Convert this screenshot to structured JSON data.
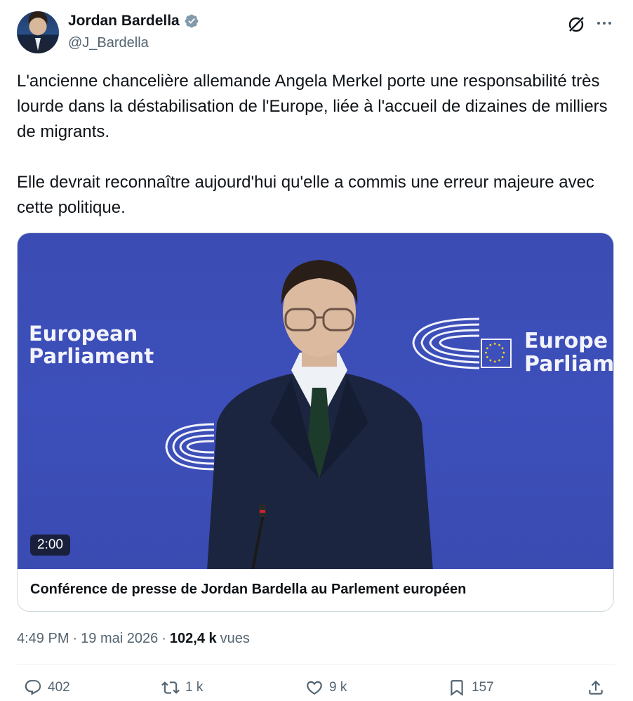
{
  "author": {
    "display_name": "Jordan Bardella",
    "handle": "@J_Bardella",
    "verified_color": "#829aab"
  },
  "tweet": {
    "text": "L'ancienne chancelière allemande Angela Merkel porte une responsabilité très lourde dans la déstabilisation de l'Europe, liée à l'accueil de dizaines de milliers de migrants.\n\nElle devrait reconnaître aujourd'hui qu'elle a commis une erreur majeure avec cette politique."
  },
  "media": {
    "duration": "2:00",
    "title": "Conférence de presse de Jordan Bardella au Parlement européen",
    "backdrop_left_line1": "European",
    "backdrop_left_line2": "Parliament",
    "backdrop_right_line1": "Europe",
    "backdrop_right_line2": "Parliam"
  },
  "meta": {
    "time": "4:49 PM",
    "separator1": "·",
    "date": "19 mai 2026",
    "separator2": "·",
    "views_count": "102,4 k",
    "views_label": "vues"
  },
  "actions": {
    "replies": "402",
    "reposts": "1 k",
    "likes": "9 k",
    "bookmarks": "157"
  },
  "colors": {
    "text_primary": "#0f1419",
    "text_secondary": "#536471",
    "video_background": "#3d4fba",
    "border": "#cfd9de"
  },
  "icons": [
    "verified-badge-icon",
    "grok-icon",
    "more-icon",
    "reply-icon",
    "repost-icon",
    "like-icon",
    "bookmark-icon",
    "share-icon"
  ]
}
